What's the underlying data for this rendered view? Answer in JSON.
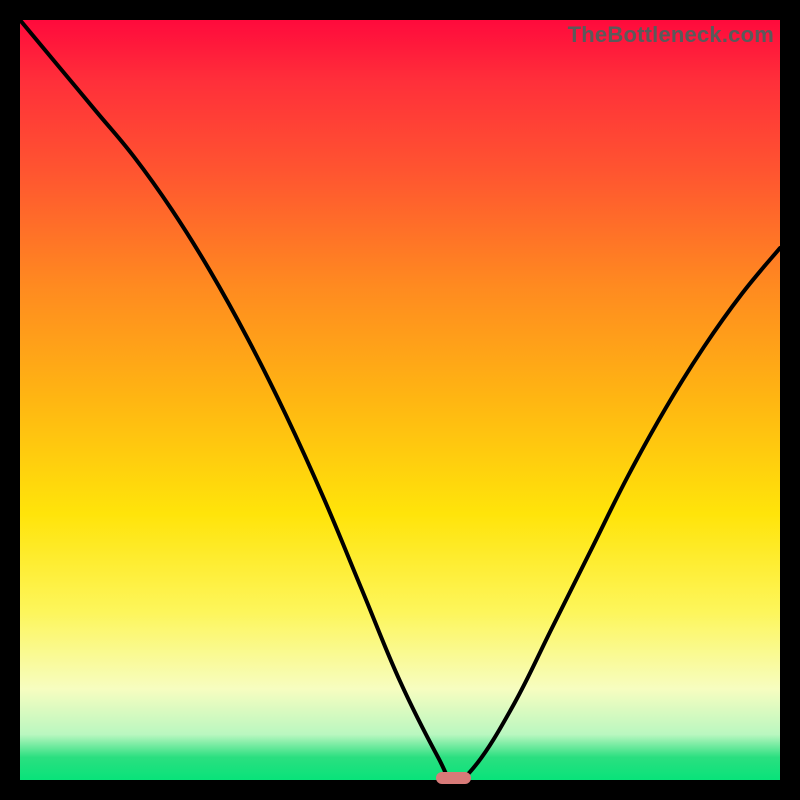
{
  "watermark": "TheBottleneck.com",
  "colors": {
    "frame": "#000000",
    "curve": "#000000",
    "marker": "#d87a78"
  },
  "chart_data": {
    "type": "line",
    "title": "",
    "xlabel": "",
    "ylabel": "",
    "xlim": [
      0,
      100
    ],
    "ylim": [
      0,
      100
    ],
    "x": [
      0,
      5,
      10,
      15,
      20,
      25,
      30,
      35,
      40,
      45,
      50,
      55,
      57,
      60,
      65,
      70,
      75,
      80,
      85,
      90,
      95,
      100
    ],
    "values": [
      100,
      94,
      88,
      82,
      75,
      67,
      58,
      48,
      37,
      25,
      13,
      3,
      0,
      2,
      10,
      20,
      30,
      40,
      49,
      57,
      64,
      70
    ],
    "marker": {
      "x": 57,
      "y": 0,
      "width_pct": 4.6,
      "height_pct": 1.7
    },
    "background_gradient": [
      {
        "pos": 0.0,
        "color": "#ff0a3c"
      },
      {
        "pos": 0.2,
        "color": "#ff5530"
      },
      {
        "pos": 0.5,
        "color": "#ffb612"
      },
      {
        "pos": 0.78,
        "color": "#fdf65c"
      },
      {
        "pos": 0.94,
        "color": "#baf7c0"
      },
      {
        "pos": 1.0,
        "color": "#08e37a"
      }
    ]
  }
}
